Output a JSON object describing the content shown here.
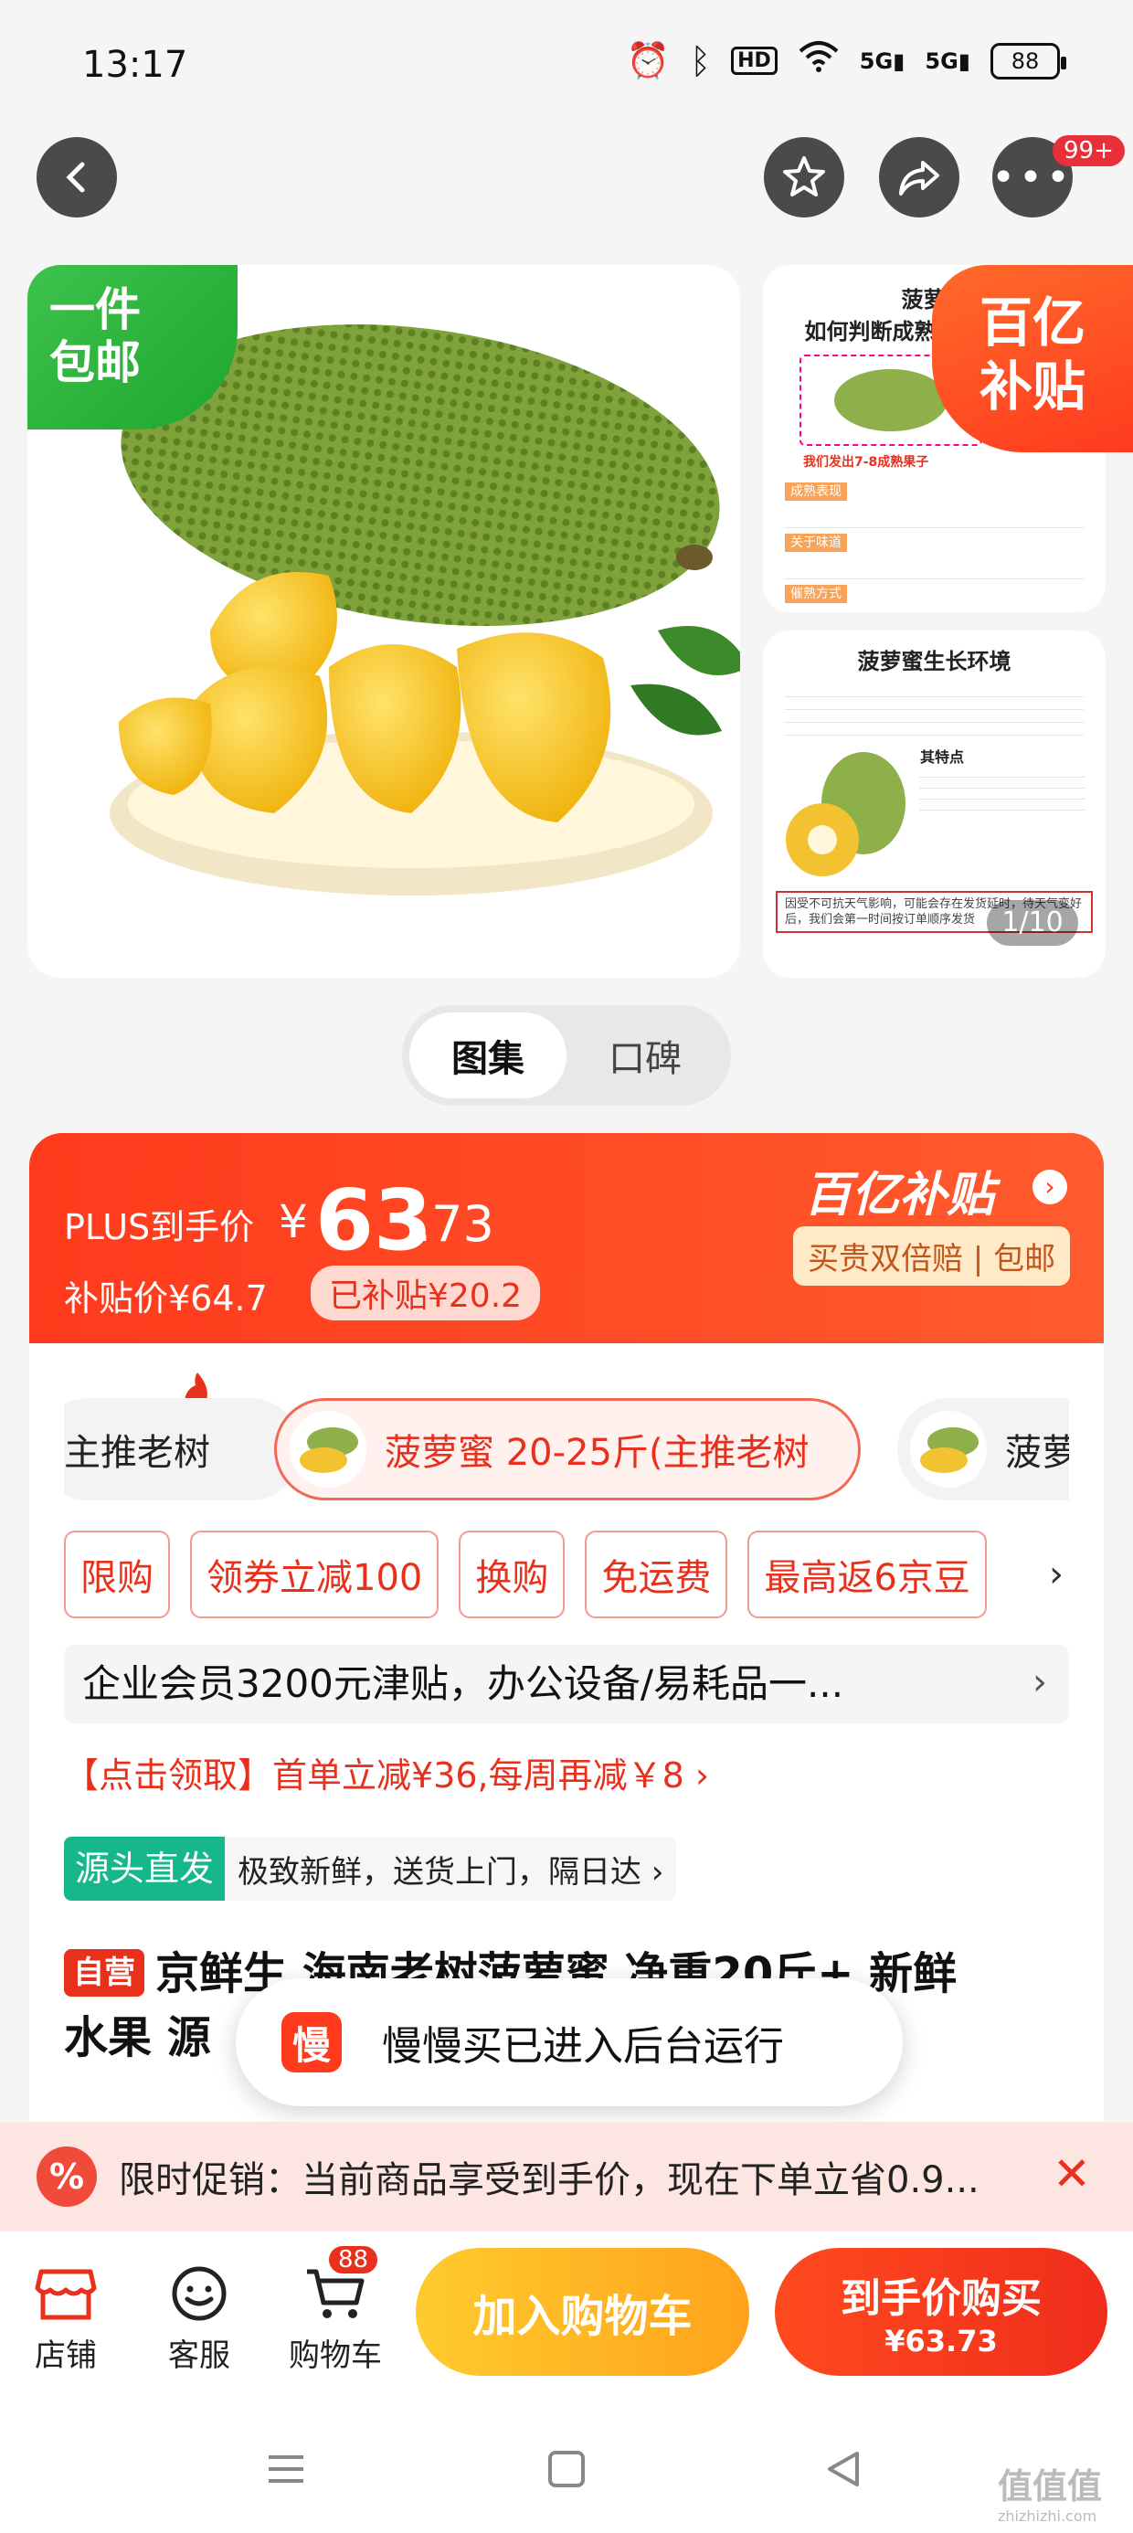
{
  "status_bar": {
    "time": "13:17",
    "hd_label": "HD",
    "signal1": "5G",
    "signal2": "5G",
    "battery": "88"
  },
  "top_nav": {
    "notification_badge": "99+"
  },
  "gallery": {
    "free_ship_line1": "一件",
    "free_ship_line2": "包邮",
    "bybt_line1": "百亿",
    "bybt_line2": "补贴",
    "side1_title_line1": "菠萝蜜",
    "side1_title_line2": "如何判断成熟",
    "side1_caption": "我们发出7-8成熟果子",
    "side1_sections": [
      "成熟表现",
      "关于味道",
      "催熟方式"
    ],
    "side2_title": "菠萝蜜生长环境",
    "side2_subtitle": "其特点",
    "side2_notice": "因受不可抗天气影响，可能会存在发货延时，待天气变好后，我们会第一时间按订单顺序发货",
    "pager": "1/10"
  },
  "tabs": [
    {
      "label": "图集"
    },
    {
      "label": "口碑"
    }
  ],
  "price": {
    "plus_label": "PLUS到手价",
    "yen": "¥",
    "integer": "63",
    "decimal": ".73",
    "subsidy_label": "补贴价¥64.7",
    "subsidy_badge": "已补贴¥20.2",
    "brand": "百亿补贴",
    "brand_arrow": "›",
    "guarantee": "买贵双倍赔 | 包邮"
  },
  "specs": [
    {
      "label": "主推老树"
    },
    {
      "label": "菠萝蜜 20-25斤(主推老树"
    },
    {
      "label": "菠萝"
    }
  ],
  "tags": [
    "限购",
    "领券立减100",
    "换购",
    "免运费",
    "最高返6京豆"
  ],
  "tags_arrow": "›",
  "enterprise": {
    "text": "企业会员3200元津贴，办公设备/易耗品一...",
    "arrow": "›"
  },
  "coupon_line": "【点击领取】首单立减¥36,每周再减￥8 ›",
  "source": {
    "badge": "源头直发",
    "text": "极致新鲜，送货上门，隔日达 ›"
  },
  "product": {
    "self_badge": "自营",
    "title_line1": "京鲜生 海南老树菠萝蜜 净重20斤+ 新鲜",
    "title_line2": "水果 源"
  },
  "toast": {
    "icon_char": "慢",
    "text": "慢慢买已进入后台运行"
  },
  "promo": {
    "icon": "%",
    "text": "限时促销：当前商品享受到手价，现在下单立省0.9...",
    "close": "✕"
  },
  "bottom_bar": {
    "shop": "店铺",
    "service": "客服",
    "cart": "购物车",
    "cart_count": "88",
    "add_cart": "加入购物车",
    "buy_now": "到手价购买",
    "buy_price": "¥63.73"
  },
  "watermark": {
    "brand": "值值值",
    "url": "zhizhizhi.com"
  },
  "colors": {
    "brand_red": "#e8301c",
    "subsidy_orange": "#ff5b2e",
    "cart_yellow": "#ffa31b",
    "free_ship_green": "#1ea62e",
    "source_green": "#16b78a"
  }
}
